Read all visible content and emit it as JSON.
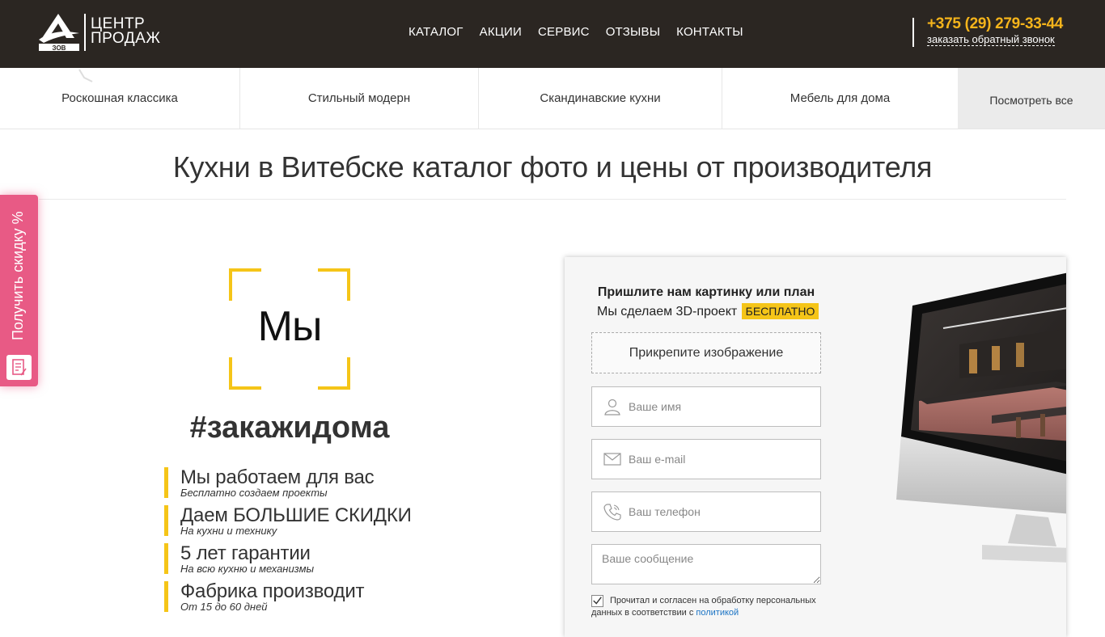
{
  "header": {
    "logo_line1": "ЦЕНТР",
    "logo_line2": "ПРОДАЖ",
    "logo_mark_text": "ЗОВ",
    "nav": [
      "КАТАЛОГ",
      "АКЦИИ",
      "СЕРВИС",
      "ОТЗЫВЫ",
      "КОНТАКТЫ"
    ],
    "phone": "+375 (29) 279-33-44",
    "callback": "заказать обратный звонок"
  },
  "categories": {
    "items": [
      "Роскошная классика",
      "Стильный модерн",
      "Скандинавские кухни",
      "Мебель для дома"
    ],
    "view_all": "Посмотреть все"
  },
  "page": {
    "title": "Кухни в Витебске каталог фото и цены от производителя"
  },
  "side_tab": {
    "label": "Получить скидку %"
  },
  "promo": {
    "frame_word": "Мы",
    "hashtag": "#закажидома",
    "features": [
      {
        "title": "Мы работаем для вас",
        "sub": "Бесплатно создаем проекты"
      },
      {
        "title": "Даем БОЛЬШИЕ СКИДКИ",
        "sub": "На кухни и технику"
      },
      {
        "title": "5 лет гарантии",
        "sub": "На всю кухню и механизмы"
      },
      {
        "title": "Фабрика производит",
        "sub": "От 15 до 60 дней"
      }
    ]
  },
  "form": {
    "heading": "Пришлите нам картинку или план",
    "subheading": "Мы сделаем 3D-проект",
    "badge": "БЕСПЛАТНО",
    "attach_label": "Прикрепите изображение",
    "name_placeholder": "Ваше имя",
    "email_placeholder": "Ваш e-mail",
    "phone_placeholder": "Ваш телефон",
    "message_placeholder": "Ваше сообщение",
    "consent_checked": true,
    "consent_line1": "Прочитал и согласен на обработку персональных",
    "consent_line2": "данных в соответствии с",
    "policy_link": "политикой"
  },
  "colors": {
    "header_bg": "#2b2622",
    "accent_yellow": "#f5c518",
    "phone": "#f5b41b",
    "side_tab": "#e85a85",
    "link": "#1a73c4"
  }
}
